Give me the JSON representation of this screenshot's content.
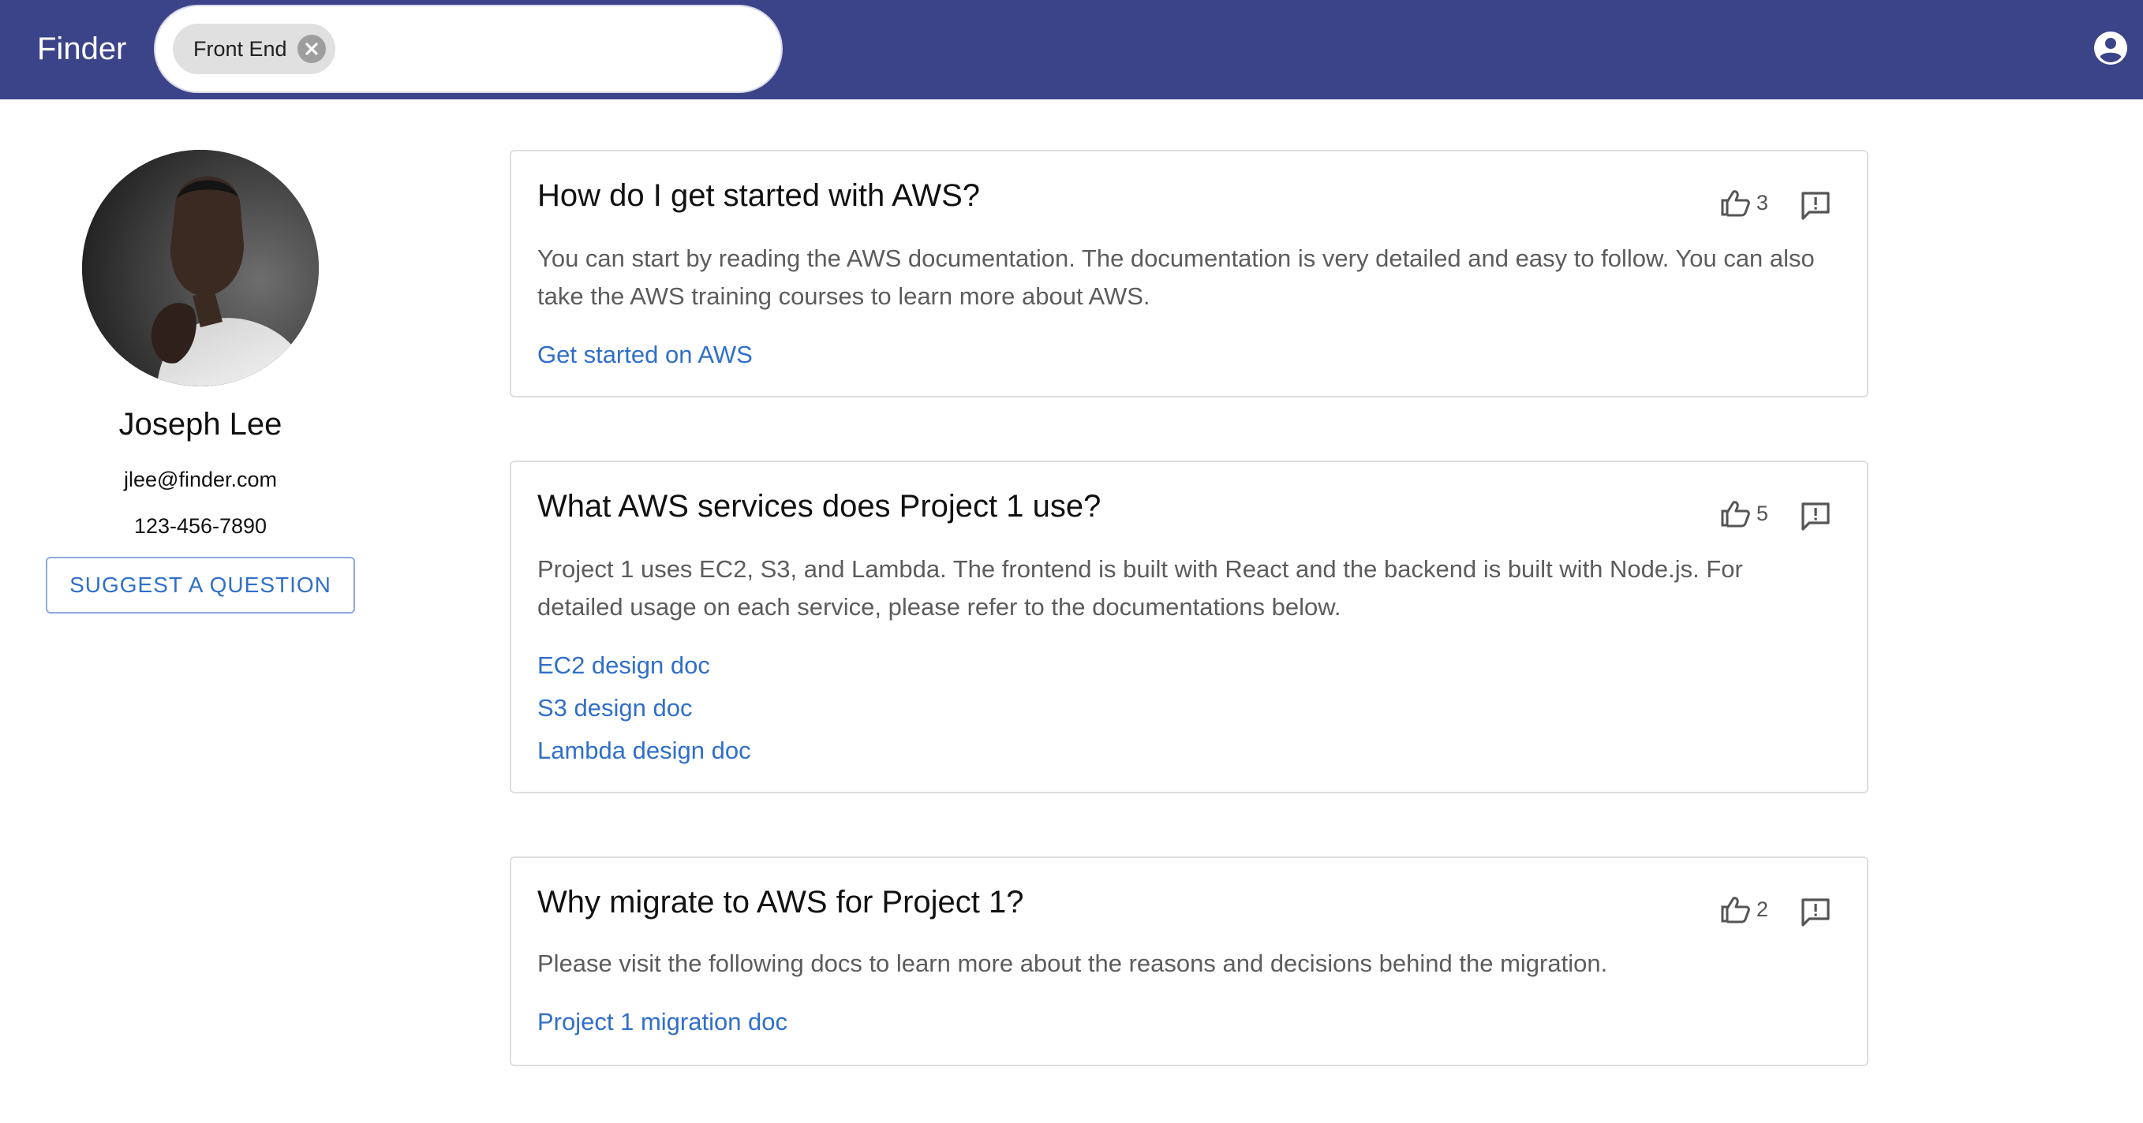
{
  "appbar": {
    "brand": "Finder",
    "search": {
      "chips": [
        {
          "label": "Front End"
        }
      ]
    }
  },
  "profile": {
    "name": "Joseph Lee",
    "email": "jlee@finder.com",
    "phone": "123-456-7890",
    "suggest_label": "SUGGEST A QUESTION"
  },
  "questions": [
    {
      "title": "How do I get started with AWS?",
      "likes": "3",
      "answer": "You can start by reading the AWS documentation. The documentation is very detailed and easy to follow. You can also take the AWS training courses to learn more about AWS.",
      "links": [
        "Get started on AWS"
      ]
    },
    {
      "title": "What AWS services does Project 1 use?",
      "likes": "5",
      "answer": "Project 1 uses EC2, S3, and Lambda. The frontend is built with React and the backend is built with Node.js. For detailed usage on each service, please refer to the documentations below.",
      "links": [
        "EC2 design doc",
        "S3 design doc",
        "Lambda design doc"
      ]
    },
    {
      "title": "Why migrate to AWS for Project 1?",
      "likes": "2",
      "answer": "Please visit the following docs to learn more about the reasons and decisions behind the migration.",
      "links": [
        "Project 1 migration doc"
      ]
    }
  ],
  "colors": {
    "appbar": "#3b4489",
    "link": "#2f6fca",
    "chip": "#e0e0e0"
  }
}
